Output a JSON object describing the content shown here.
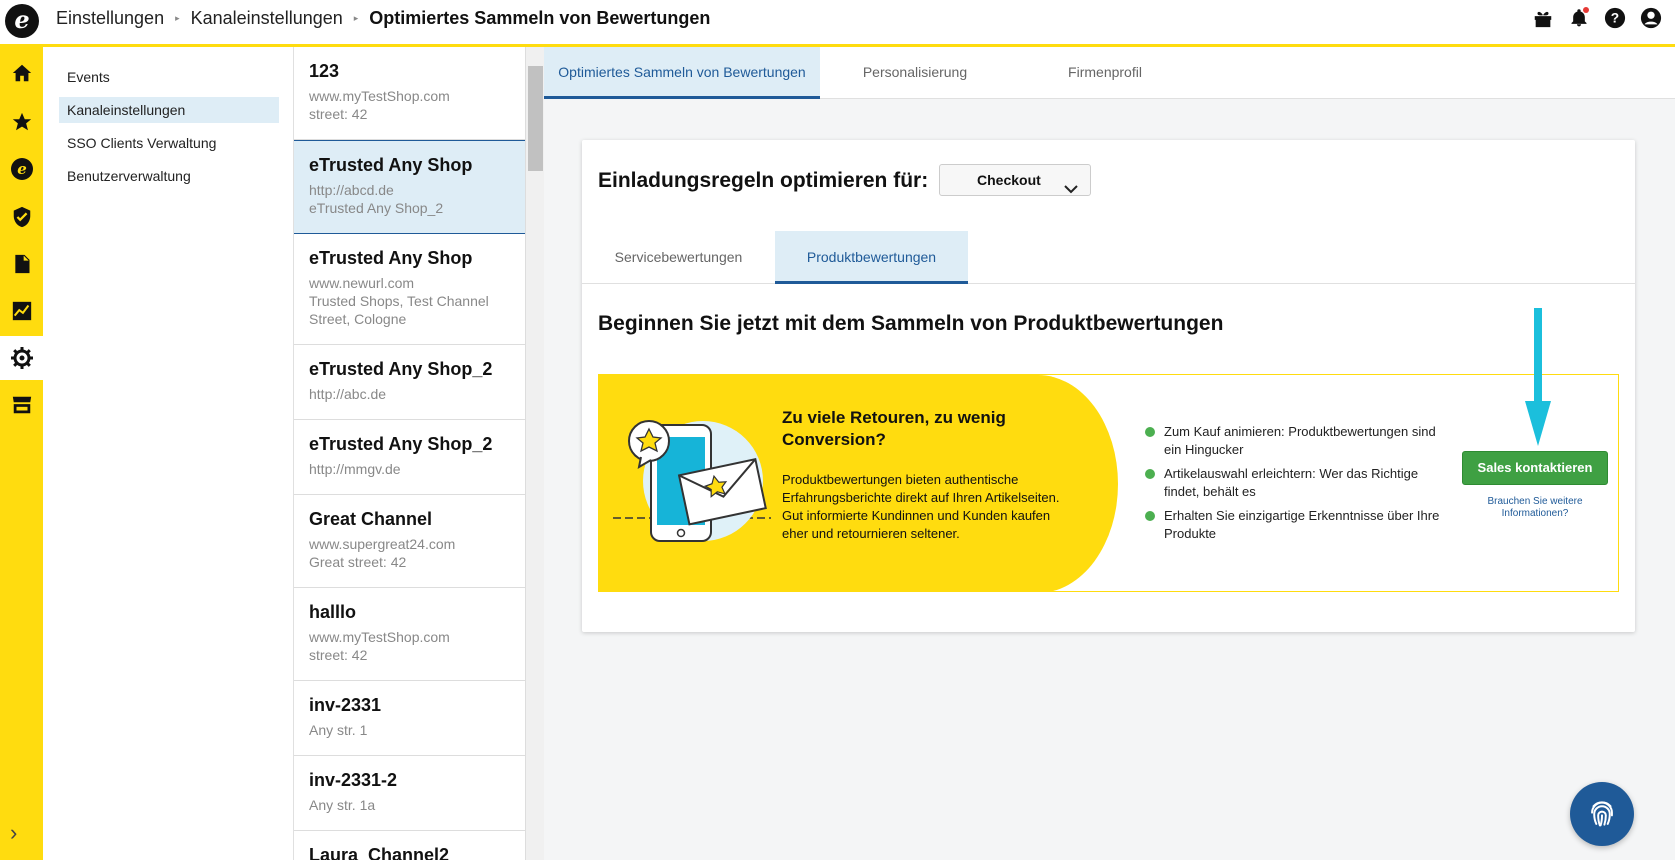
{
  "header": {
    "logo_letter": "e",
    "breadcrumbs": [
      "Einstellungen",
      "Kanaleinstellungen",
      "Optimiertes Sammeln von Bewertungen"
    ],
    "icons": [
      "gift-icon",
      "bell-icon",
      "help-icon",
      "account-icon"
    ]
  },
  "rail": {
    "icons": [
      "home-icon",
      "star-icon",
      "etrusted-icon",
      "shield-icon",
      "document-icon",
      "analytics-icon",
      "settings-icon",
      "shop-icon"
    ],
    "active": "settings-icon"
  },
  "settings_nav": {
    "items": [
      {
        "label": "Events"
      },
      {
        "label": "Kanaleinstellungen",
        "selected": true
      },
      {
        "label": "SSO Clients Verwaltung"
      },
      {
        "label": "Benutzerverwaltung"
      }
    ]
  },
  "channels": [
    {
      "name": "123",
      "lines": [
        "www.myTestShop.com",
        "street: 42"
      ]
    },
    {
      "name": "eTrusted Any Shop",
      "lines": [
        "http://abcd.de",
        "eTrusted Any Shop_2"
      ],
      "selected": true
    },
    {
      "name": "eTrusted Any Shop",
      "lines": [
        "www.newurl.com",
        "Trusted Shops, Test Channel",
        "Street, Cologne"
      ]
    },
    {
      "name": "eTrusted Any Shop_2",
      "lines": [
        "http://abc.de"
      ]
    },
    {
      "name": "eTrusted Any Shop_2",
      "lines": [
        "http://mmgv.de"
      ]
    },
    {
      "name": "Great Channel",
      "lines": [
        "www.supergreat24.com",
        "Great street: 42"
      ]
    },
    {
      "name": "halllo",
      "lines": [
        "www.myTestShop.com",
        "street: 42"
      ]
    },
    {
      "name": "inv-2331",
      "lines": [
        "Any str. 1"
      ]
    },
    {
      "name": "inv-2331-2",
      "lines": [
        "Any str. 1a"
      ]
    },
    {
      "name": "Laura_Channel2",
      "lines": []
    }
  ],
  "main_tabs": [
    {
      "label": "Optimiertes Sammeln von Bewertungen",
      "active": true
    },
    {
      "label": "Personalisierung"
    },
    {
      "label": "Firmenprofil"
    }
  ],
  "card": {
    "title": "Einladungsregeln optimieren für:",
    "dropdown_value": "Checkout",
    "tabs": [
      {
        "label": "Servicebewertungen"
      },
      {
        "label": "Produktbewertungen",
        "active": true
      }
    ],
    "heading": "Beginnen Sie jetzt mit dem Sammeln von Produktbewertungen",
    "banner": {
      "headline": "Zu viele Retouren, zu wenig Conversion?",
      "text": "Produktbewertungen bieten authentische Erfahrungsberichte direkt auf Ihren Artikelseiten. Gut informierte Kundinnen und Kunden kaufen eher und retournieren seltener.",
      "bullets": [
        "Zum Kauf animieren: Produktbewertungen sind ein Hingucker",
        "Artikelauswahl erleichtern: Wer das Richtige findet, behält es",
        "Erhalten Sie einzigartige Erkenntnisse über Ihre Produkte"
      ],
      "button": "Sales kontaktieren",
      "link": "Brauchen Sie weitere Informationen?"
    }
  },
  "colors": {
    "brand_yellow": "#ffdc0f",
    "primary_blue": "#1f5a98",
    "selected_bg": "#deedf6",
    "success_green": "#3fa043",
    "annotation_cyan": "#1bbfdc"
  }
}
